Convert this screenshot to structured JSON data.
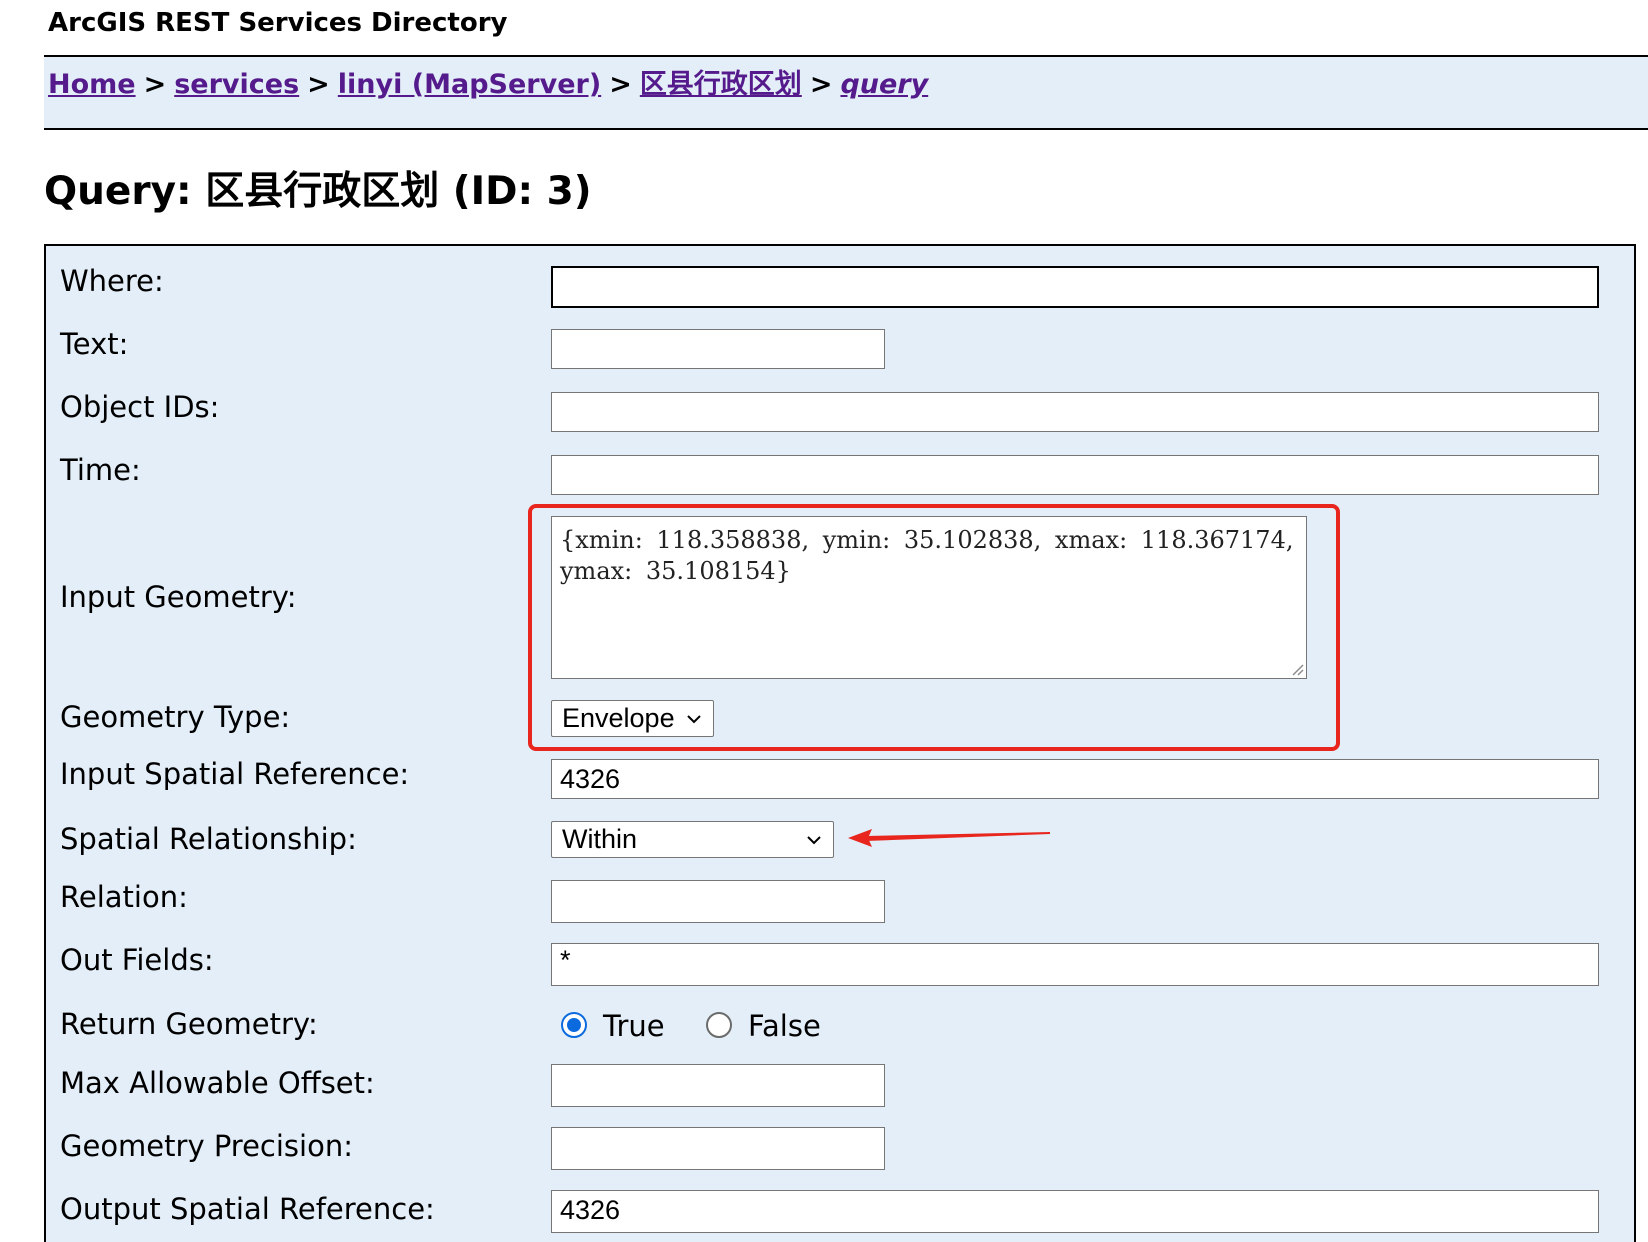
{
  "header": {
    "app_title": "ArcGIS REST Services Directory"
  },
  "breadcrumb": {
    "items": [
      {
        "label": "Home"
      },
      {
        "label": "services"
      },
      {
        "label": "linyi (MapServer)"
      },
      {
        "label": "区县行政区划"
      },
      {
        "label": "query"
      }
    ],
    "separator": ">"
  },
  "page": {
    "title": "Query: 区县行政区划 (ID: 3)"
  },
  "form": {
    "where": {
      "label": "Where:",
      "value": ""
    },
    "text": {
      "label": "Text:",
      "value": ""
    },
    "object_ids": {
      "label": "Object IDs:",
      "value": ""
    },
    "time": {
      "label": "Time:",
      "value": ""
    },
    "input_geometry": {
      "label": "Input Geometry:",
      "value": "{xmin: 118.358838, ymin: 35.102838, xmax: 118.367174, ymax: 35.108154}"
    },
    "geometry_type": {
      "label": "Geometry Type:",
      "selected": "Envelope"
    },
    "input_spatial_reference": {
      "label": "Input Spatial Reference:",
      "value": "4326"
    },
    "spatial_relationship": {
      "label": "Spatial Relationship:",
      "selected": "Within"
    },
    "relation": {
      "label": "Relation:",
      "value": ""
    },
    "out_fields": {
      "label": "Out Fields:",
      "value": "*"
    },
    "return_geometry": {
      "label": "Return Geometry:",
      "options": [
        {
          "label": "True",
          "checked": true
        },
        {
          "label": "False",
          "checked": false
        }
      ]
    },
    "max_allowable_offset": {
      "label": "Max Allowable Offset:",
      "value": ""
    },
    "geometry_precision": {
      "label": "Geometry Precision:",
      "value": ""
    },
    "output_spatial_reference": {
      "label": "Output Spatial Reference:",
      "value": "4326"
    }
  },
  "annotations": {
    "highlight_color": "#e8261e",
    "radio_accent": "#0b6bde",
    "link_color": "#551a8b",
    "panel_background": "#e3eef8"
  }
}
